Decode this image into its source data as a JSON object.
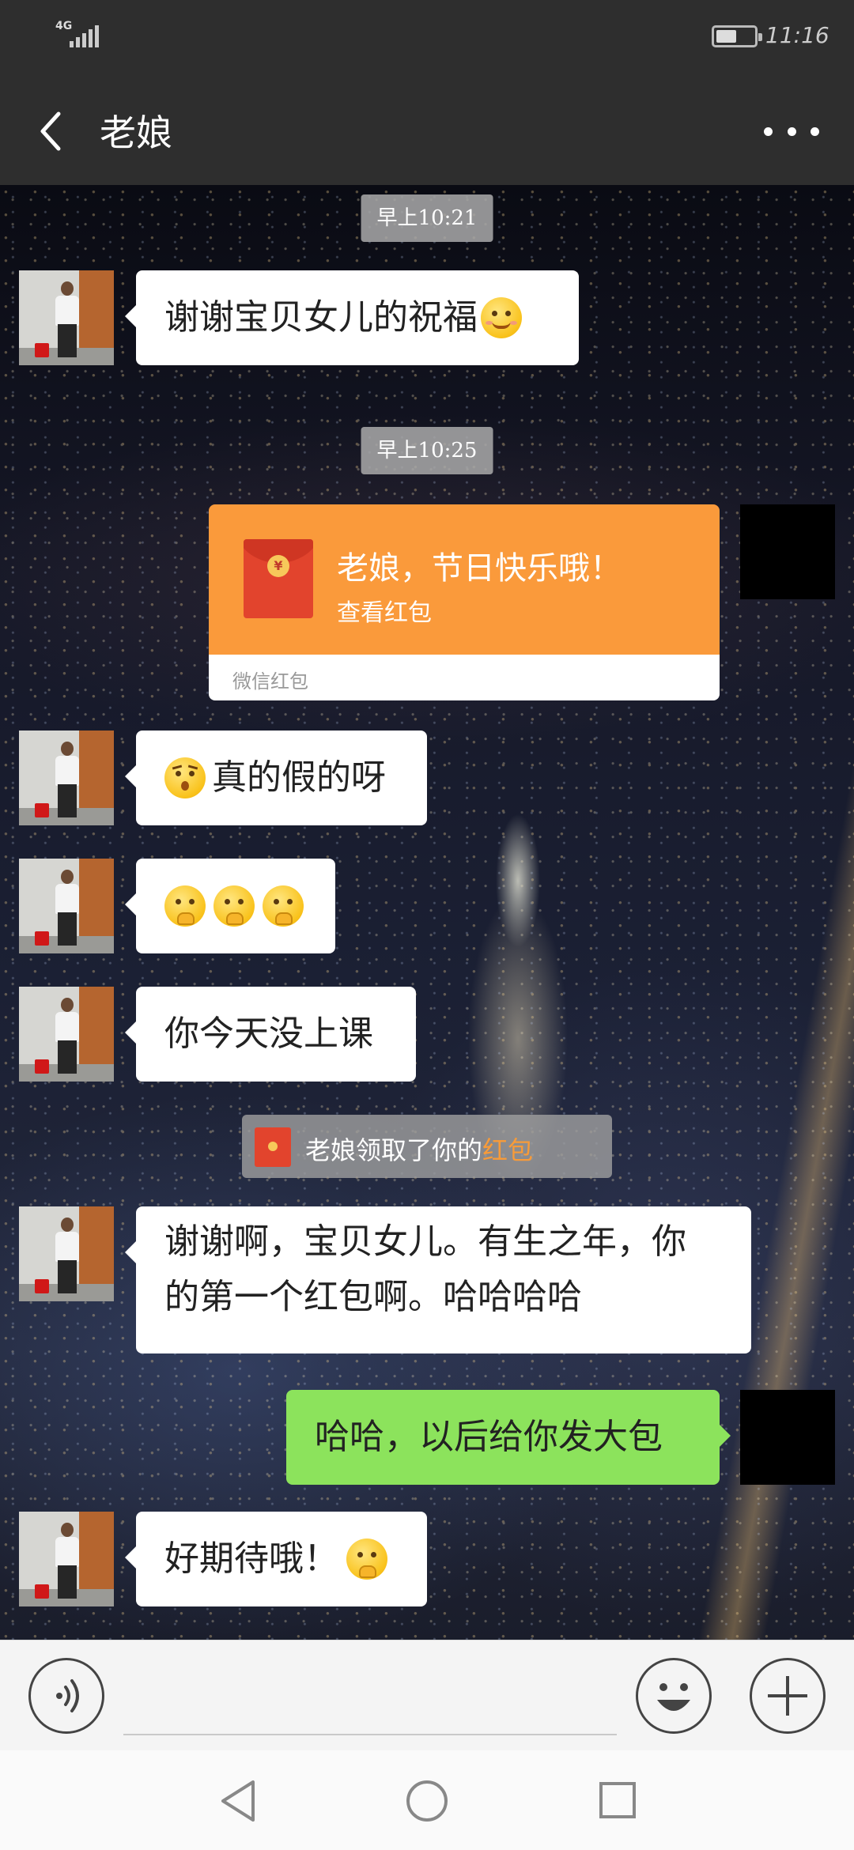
{
  "status_bar": {
    "network": "4G",
    "time": "11:16",
    "battery_level": 0.55
  },
  "header": {
    "title": "老娘",
    "back_icon": "chevron-left-icon",
    "more_icon": "more-dots-icon"
  },
  "messages": [
    {
      "type": "timestamp",
      "text": "早上10:21"
    },
    {
      "type": "text",
      "side": "left",
      "text": "谢谢宝贝女儿的祝福",
      "emoji": "smile-emoji"
    },
    {
      "type": "timestamp",
      "text": "早上10:25"
    },
    {
      "type": "red_packet",
      "side": "right",
      "title": "老娘，节日快乐哦！",
      "subtitle": "查看红包",
      "source": "微信红包"
    },
    {
      "type": "text",
      "side": "left",
      "text": "真的假的呀",
      "emoji": "surprised-emoji"
    },
    {
      "type": "text",
      "side": "left",
      "text": "",
      "emoji": "thinking-emoji x3"
    },
    {
      "type": "text",
      "side": "left",
      "text": "你今天没上课"
    },
    {
      "type": "system",
      "text_prefix": "老娘领取了你的",
      "text_highlight": "红包",
      "highlight_color": "#f79b39"
    },
    {
      "type": "text",
      "side": "left",
      "lines": [
        "谢谢啊，宝贝女儿。有生之年，你",
        "的第一个红包啊。哈哈哈哈"
      ]
    },
    {
      "type": "text",
      "side": "right",
      "text": "哈哈，以后给你发大包"
    },
    {
      "type": "text",
      "side": "left",
      "text": "好期待哦！",
      "emoji": "thinking-emoji"
    }
  ],
  "input_bar": {
    "voice_icon": "voice-icon",
    "emoji_icon": "emoji-icon",
    "add_icon": "plus-icon"
  },
  "colors": {
    "header_bg": "#2e2e2e",
    "sent_bubble": "#8ce35c",
    "red_packet": "#fa9a3b"
  }
}
